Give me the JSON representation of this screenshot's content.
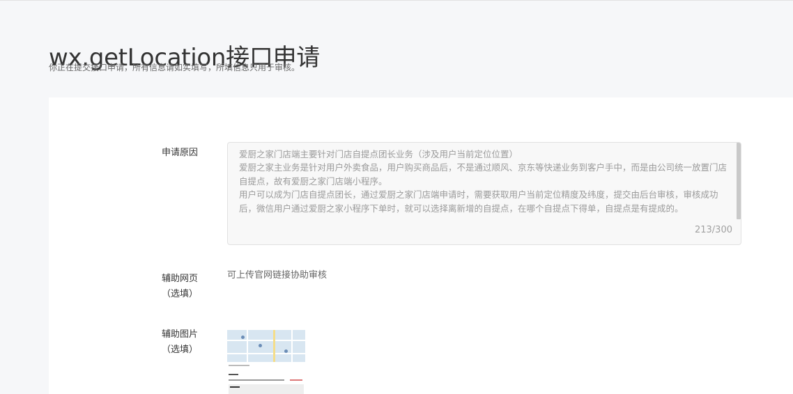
{
  "header": {
    "title": "wx.getLocation接口申请",
    "subtitle": "你正在提交接口申请，所有信息请如实填写，所填信息只用于审核。"
  },
  "form": {
    "reason": {
      "label": "申请原因",
      "value": "爱厨之家门店端主要针对门店自提点团长业务（涉及用户当前定位位置）\n爱厨之家主业务是针对用户外卖食品，用户购买商品后，不是通过顺风、京东等快递业务到客户手中，而是由公司统一放置门店自提点，故有爱厨之家门店端小程序。\n用户可以成为门店自提点团长，通过爱厨之家门店端申请时，需要获取用户当前定位精度及纬度，提交由后台审核，审核成功后，微信用户通过爱厨之家小程序下单时，就可以选择离新增的自提点，在哪个自提点下得单，自提点是有提成的。",
      "counter": "213/300"
    },
    "webpage": {
      "label_line1": "辅助网页",
      "label_line2": "（选填）",
      "hint": "可上传官网链接协助审核"
    },
    "image": {
      "label_line1": "辅助图片",
      "label_line2": "（选填）"
    }
  }
}
